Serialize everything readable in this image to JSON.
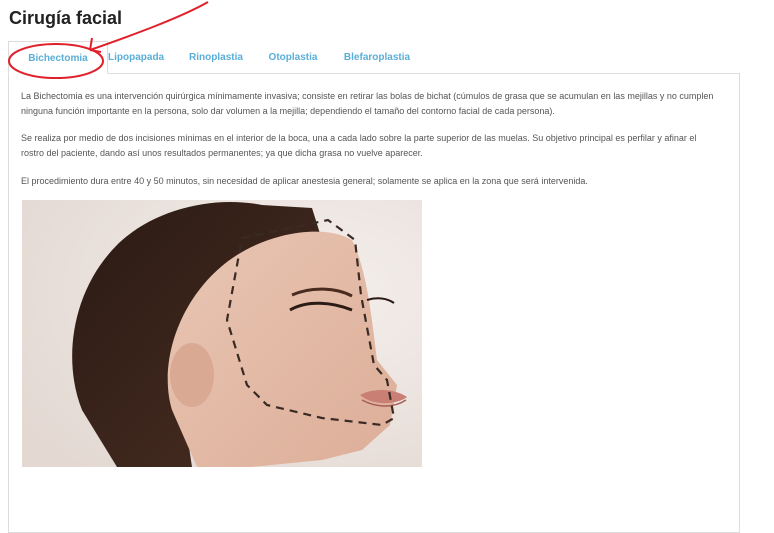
{
  "page": {
    "title": "Cirugía facial"
  },
  "tabs": [
    {
      "label": "Bichectomia",
      "active": true
    },
    {
      "label": "Lipopapada",
      "active": false
    },
    {
      "label": "Rinoplastia",
      "active": false
    },
    {
      "label": "Otoplastia",
      "active": false
    },
    {
      "label": "Blefaroplastia",
      "active": false
    }
  ],
  "content": {
    "paragraphs": [
      "La Bichectomia es una intervención quirúrgica mínimamente invasiva; consiste en retirar las bolas de bichat (cúmulos de grasa que se acumulan en las mejillas y no cumplen ninguna función importante en la persona, solo dar volumen a la mejilla; dependiendo el tamaño del contorno facial de cada persona).",
      "Se realiza por medio de dos incisiones mínimas en el interior de la boca, una a cada lado sobre la parte superior de las muelas. Su objetivo principal es perfilar y afinar el rostro del paciente, dando así unos resultados permanentes; ya que dicha grasa no vuelve aparecer.",
      "El procedimiento dura entre 40 y 50 minutos, sin necesidad de aplicar anestesia general; solamente se aplica en la zona que será intervenida."
    ]
  },
  "colors": {
    "tab_text": "#5aaed8",
    "annotation": "#e0202a",
    "body_text": "#555555"
  }
}
